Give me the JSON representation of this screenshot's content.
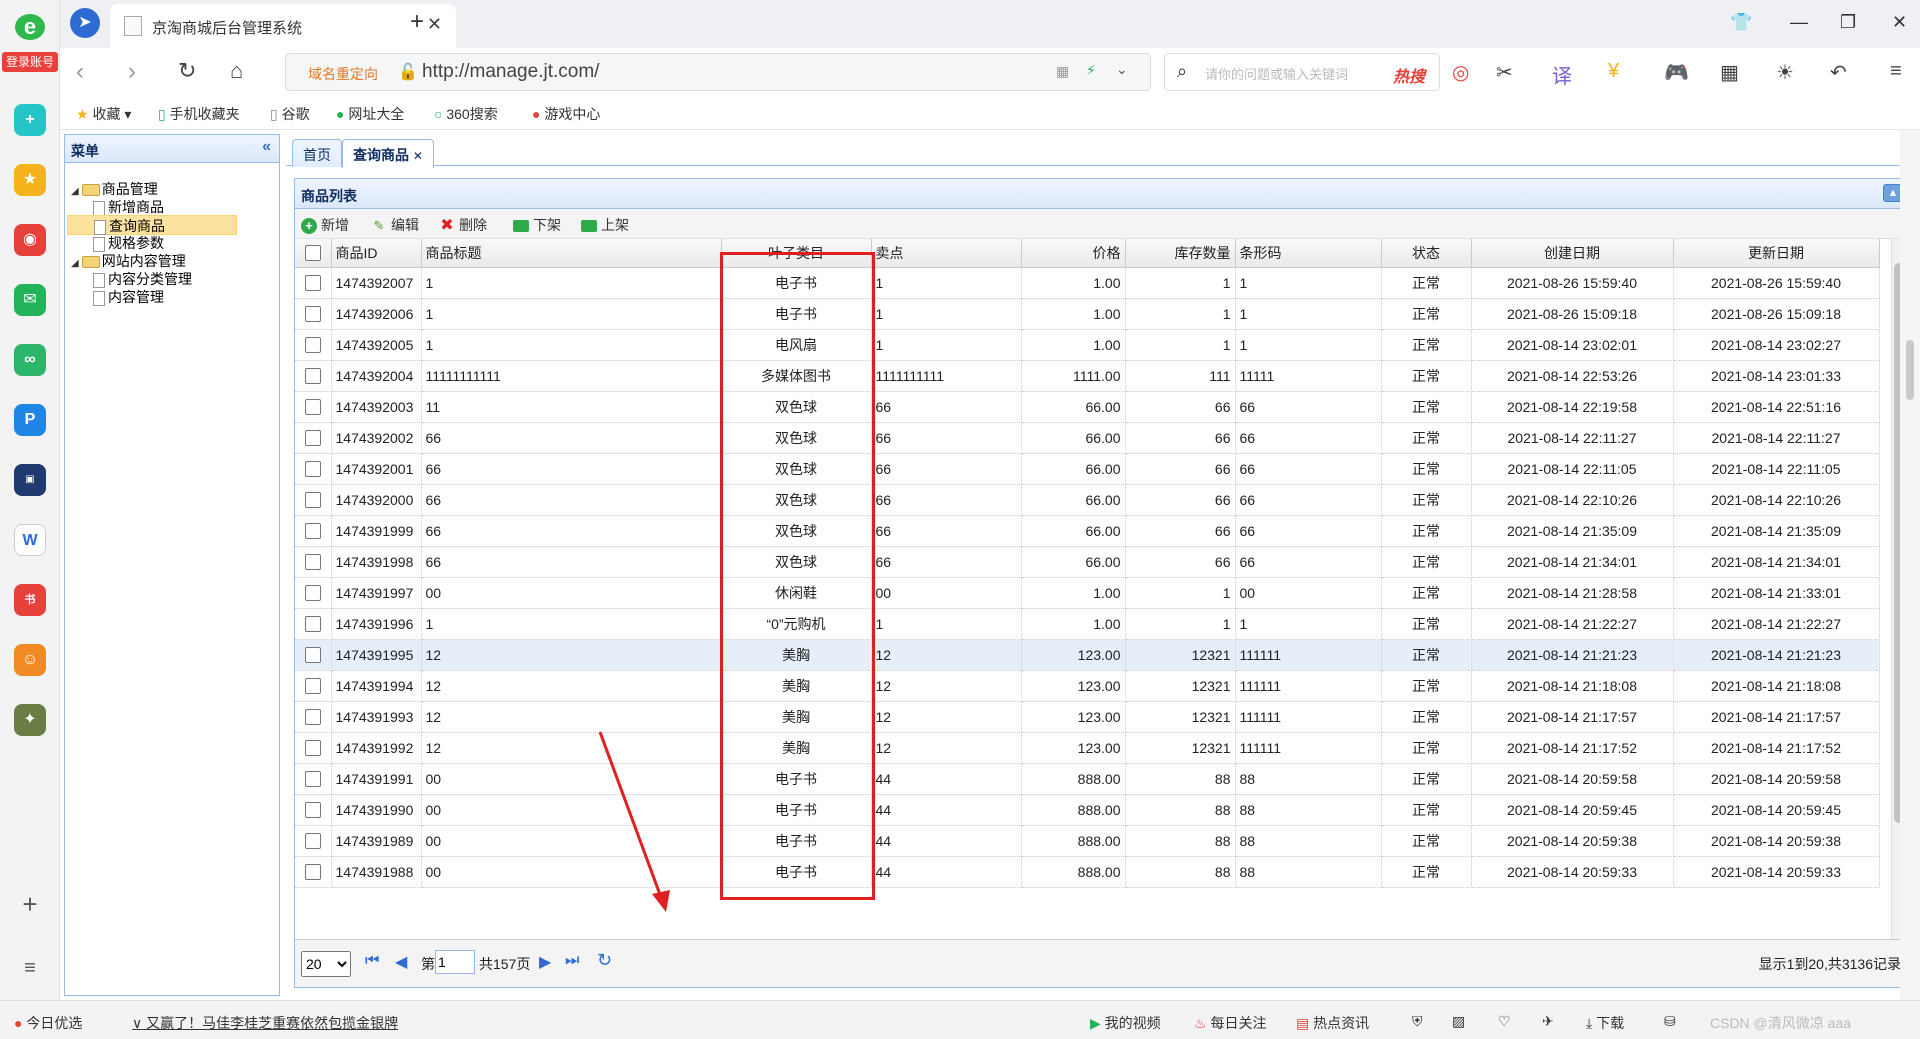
{
  "browser": {
    "tab_title": "京淘商城后台管理系统",
    "address_redirect": "域名重定向",
    "url": "http://manage.jt.com/",
    "search_placeholder": "请你的问题或输入关键词",
    "hot_label": "热搜",
    "login_label": "登录账号"
  },
  "bookmarks": [
    "收藏",
    "手机收藏夹",
    "谷歌",
    "网址大全",
    "360搜索",
    "游戏中心"
  ],
  "menu": {
    "title": "菜单",
    "tree": [
      {
        "label": "商品管理",
        "children": [
          "新增商品",
          "查询商品",
          "规格参数"
        ]
      },
      {
        "label": "网站内容管理",
        "children": [
          "内容分类管理",
          "内容管理"
        ]
      }
    ]
  },
  "tabs": [
    "首页",
    "查询商品"
  ],
  "panel": {
    "title": "商品列表"
  },
  "toolbar": {
    "add": "新增",
    "edit": "编辑",
    "delete": "删除",
    "unshelve": "下架",
    "shelve": "上架"
  },
  "columns": [
    "商品ID",
    "商品标题",
    "叶子类目",
    "卖点",
    "价格",
    "库存数量",
    "条形码",
    "状态",
    "创建日期",
    "更新日期"
  ],
  "rows": [
    [
      "1474392007",
      "1",
      "电子书",
      "1",
      "1.00",
      "1",
      "1",
      "正常",
      "2021-08-26 15:59:40",
      "2021-08-26 15:59:40"
    ],
    [
      "1474392006",
      "1",
      "电子书",
      "1",
      "1.00",
      "1",
      "1",
      "正常",
      "2021-08-26 15:09:18",
      "2021-08-26 15:09:18"
    ],
    [
      "1474392005",
      "1",
      "电风扇",
      "1",
      "1.00",
      "1",
      "1",
      "正常",
      "2021-08-14 23:02:01",
      "2021-08-14 23:02:27"
    ],
    [
      "1474392004",
      "11111111111",
      "多媒体图书",
      "1111111111",
      "1111.00",
      "111",
      "11111",
      "正常",
      "2021-08-14 22:53:26",
      "2021-08-14 23:01:33"
    ],
    [
      "1474392003",
      "11",
      "双色球",
      "66",
      "66.00",
      "66",
      "66",
      "正常",
      "2021-08-14 22:19:58",
      "2021-08-14 22:51:16"
    ],
    [
      "1474392002",
      "66",
      "双色球",
      "66",
      "66.00",
      "66",
      "66",
      "正常",
      "2021-08-14 22:11:27",
      "2021-08-14 22:11:27"
    ],
    [
      "1474392001",
      "66",
      "双色球",
      "66",
      "66.00",
      "66",
      "66",
      "正常",
      "2021-08-14 22:11:05",
      "2021-08-14 22:11:05"
    ],
    [
      "1474392000",
      "66",
      "双色球",
      "66",
      "66.00",
      "66",
      "66",
      "正常",
      "2021-08-14 22:10:26",
      "2021-08-14 22:10:26"
    ],
    [
      "1474391999",
      "66",
      "双色球",
      "66",
      "66.00",
      "66",
      "66",
      "正常",
      "2021-08-14 21:35:09",
      "2021-08-14 21:35:09"
    ],
    [
      "1474391998",
      "66",
      "双色球",
      "66",
      "66.00",
      "66",
      "66",
      "正常",
      "2021-08-14 21:34:01",
      "2021-08-14 21:34:01"
    ],
    [
      "1474391997",
      "00",
      "休闲鞋",
      "00",
      "1.00",
      "1",
      "00",
      "正常",
      "2021-08-14 21:28:58",
      "2021-08-14 21:33:01"
    ],
    [
      "1474391996",
      "1",
      "“0”元购机",
      "1",
      "1.00",
      "1",
      "1",
      "正常",
      "2021-08-14 21:22:27",
      "2021-08-14 21:22:27"
    ],
    [
      "1474391995",
      "12",
      "美胸",
      "12",
      "123.00",
      "12321",
      "111111",
      "正常",
      "2021-08-14 21:21:23",
      "2021-08-14 21:21:23"
    ],
    [
      "1474391994",
      "12",
      "美胸",
      "12",
      "123.00",
      "12321",
      "111111",
      "正常",
      "2021-08-14 21:18:08",
      "2021-08-14 21:18:08"
    ],
    [
      "1474391993",
      "12",
      "美胸",
      "12",
      "123.00",
      "12321",
      "111111",
      "正常",
      "2021-08-14 21:17:57",
      "2021-08-14 21:17:57"
    ],
    [
      "1474391992",
      "12",
      "美胸",
      "12",
      "123.00",
      "12321",
      "111111",
      "正常",
      "2021-08-14 21:17:52",
      "2021-08-14 21:17:52"
    ],
    [
      "1474391991",
      "00",
      "电子书",
      "44",
      "888.00",
      "88",
      "88",
      "正常",
      "2021-08-14 20:59:58",
      "2021-08-14 20:59:58"
    ],
    [
      "1474391990",
      "00",
      "电子书",
      "44",
      "888.00",
      "88",
      "88",
      "正常",
      "2021-08-14 20:59:45",
      "2021-08-14 20:59:45"
    ],
    [
      "1474391989",
      "00",
      "电子书",
      "44",
      "888.00",
      "88",
      "88",
      "正常",
      "2021-08-14 20:59:38",
      "2021-08-14 20:59:38"
    ],
    [
      "1474391988",
      "00",
      "电子书",
      "44",
      "888.00",
      "88",
      "88",
      "正常",
      "2021-08-14 20:59:33",
      "2021-08-14 20:59:33"
    ]
  ],
  "highlighted_row": 12,
  "pager": {
    "page_size": "20",
    "page_prefix": "第",
    "page": "1",
    "total_pages": "共157页",
    "info": "显示1到20,共3136记录"
  },
  "statusbar": {
    "today": "今日优选",
    "news": "又赢了！马佳李桂芝重赛依然包揽金银牌",
    "video": "我的视频",
    "follow": "每日关注",
    "hot": "热点资讯",
    "download": "下载",
    "watermark": "CSDN @清风微凉 aaa"
  }
}
